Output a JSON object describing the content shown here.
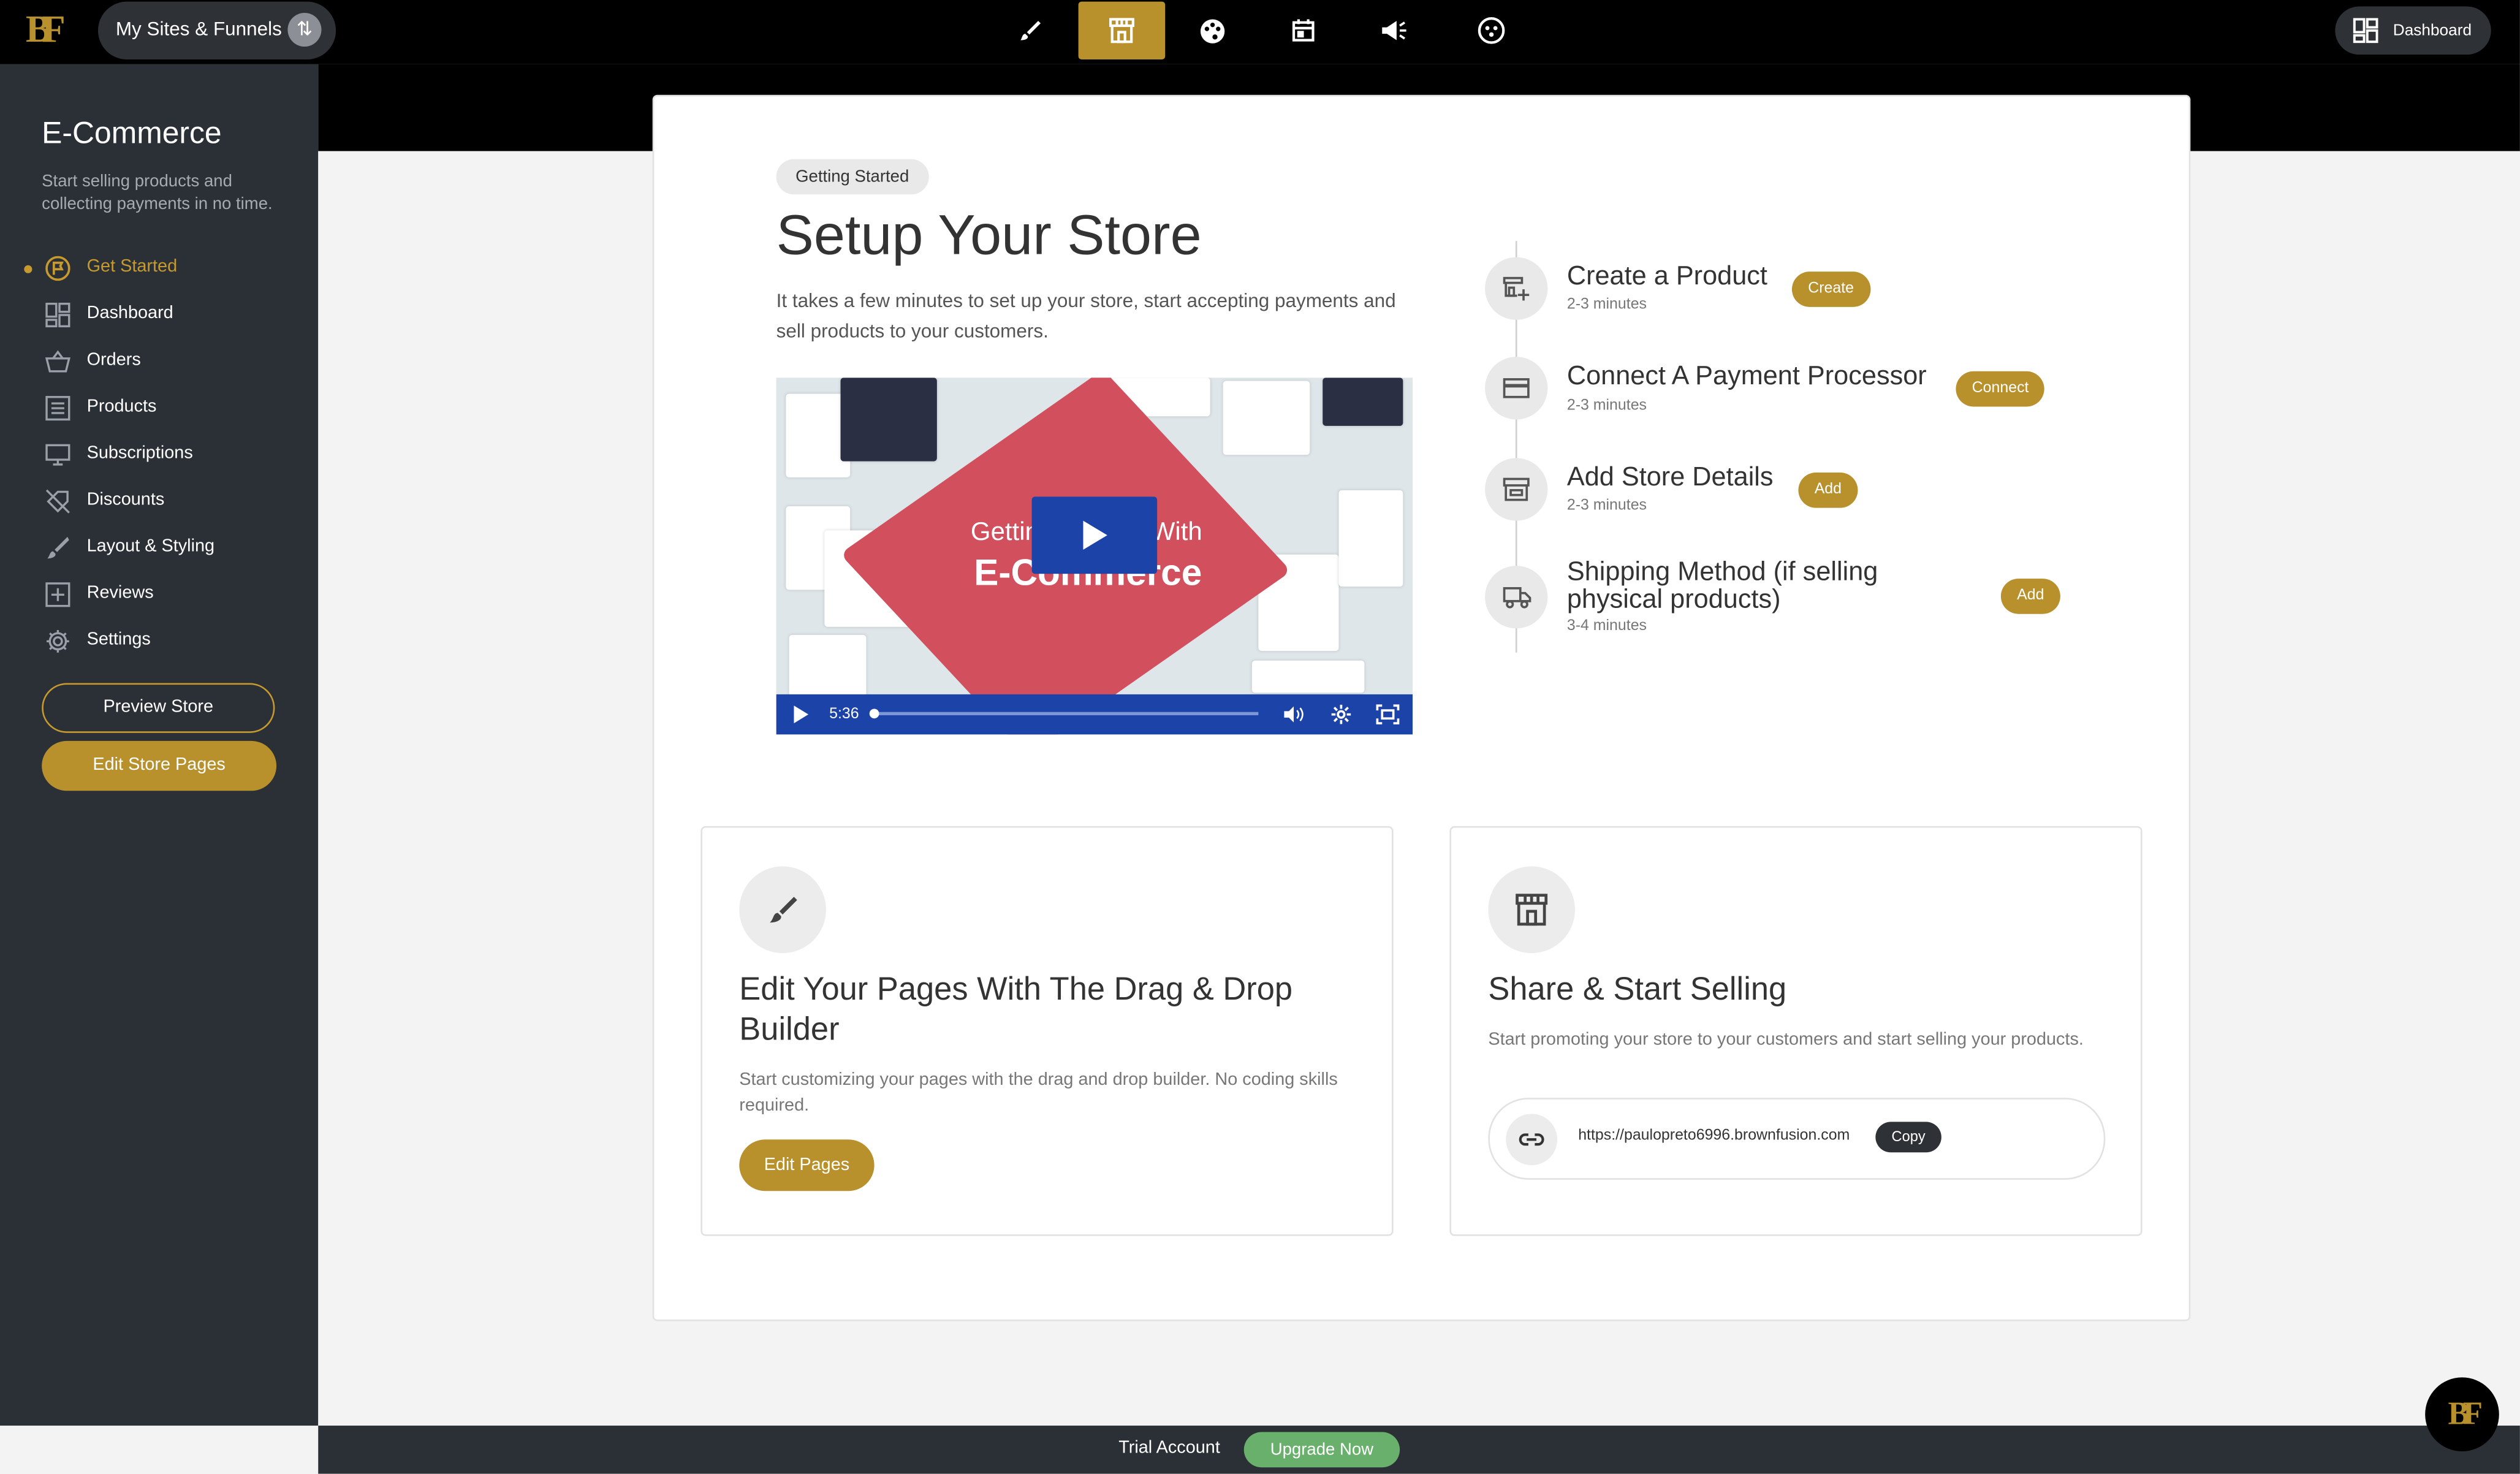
{
  "topbar": {
    "logo": "BF",
    "sites_label": "My Sites & Funnels",
    "dashboard_label": "Dashboard",
    "nav_icons": [
      "brush-icon",
      "store-icon",
      "palette-icon",
      "calendar-icon",
      "megaphone-icon",
      "smiley-icon"
    ],
    "active_nav": "store-icon"
  },
  "sidebar": {
    "title": "E-Commerce",
    "description": "Start selling products and collecting payments in no time.",
    "items": [
      {
        "label": "Get Started",
        "icon": "flag-circle-icon",
        "active": true
      },
      {
        "label": "Dashboard",
        "icon": "grid-icon"
      },
      {
        "label": "Orders",
        "icon": "basket-icon"
      },
      {
        "label": "Products",
        "icon": "list-icon"
      },
      {
        "label": "Subscriptions",
        "icon": "monitor-icon"
      },
      {
        "label": "Discounts",
        "icon": "discount-off-icon"
      },
      {
        "label": "Layout & Styling",
        "icon": "brush-icon"
      },
      {
        "label": "Reviews",
        "icon": "plus-box-icon"
      },
      {
        "label": "Settings",
        "icon": "gear-icon"
      }
    ],
    "preview_label": "Preview Store",
    "edit_store_label": "Edit Store Pages"
  },
  "main": {
    "badge": "Getting Started",
    "title": "Setup Your Store",
    "lead": "It takes a few minutes to set up your store, start accepting payments and sell products to your customers.",
    "video": {
      "title_line1": "Getting Started With",
      "title_line2": "E-Commerce",
      "time": "5:36",
      "progress": 0.0
    },
    "steps": [
      {
        "title": "Create a Product",
        "duration": "2-3 minutes",
        "button": "Create",
        "icon": "product-add-icon"
      },
      {
        "title": "Connect A Payment Processor",
        "duration": "2-3 minutes",
        "button": "Connect",
        "icon": "credit-card-icon"
      },
      {
        "title": "Add Store Details",
        "duration": "2-3 minutes",
        "button": "Add",
        "icon": "storefront-icon"
      },
      {
        "title": "Shipping Method (if selling physical products)",
        "duration": "3-4 minutes",
        "button": "Add",
        "icon": "truck-icon"
      }
    ],
    "edit_card": {
      "title": "Edit Your Pages With The Drag & Drop Builder",
      "description": "Start customizing your pages with the drag and drop builder. No coding skills required.",
      "button": "Edit Pages"
    },
    "share_card": {
      "title": "Share & Start Selling",
      "description": "Start promoting your store to your customers and start selling your products.",
      "url": "https://paulopreto6996.brownfusion.com",
      "copy_label": "Copy"
    }
  },
  "footer": {
    "trial_label": "Trial Account",
    "upgrade_label": "Upgrade Now"
  },
  "colors": {
    "accent": "#b8902c",
    "sidebar_bg": "#2b2f36",
    "upgrade": "#6ab06d",
    "video_bar": "#1c43a8"
  }
}
